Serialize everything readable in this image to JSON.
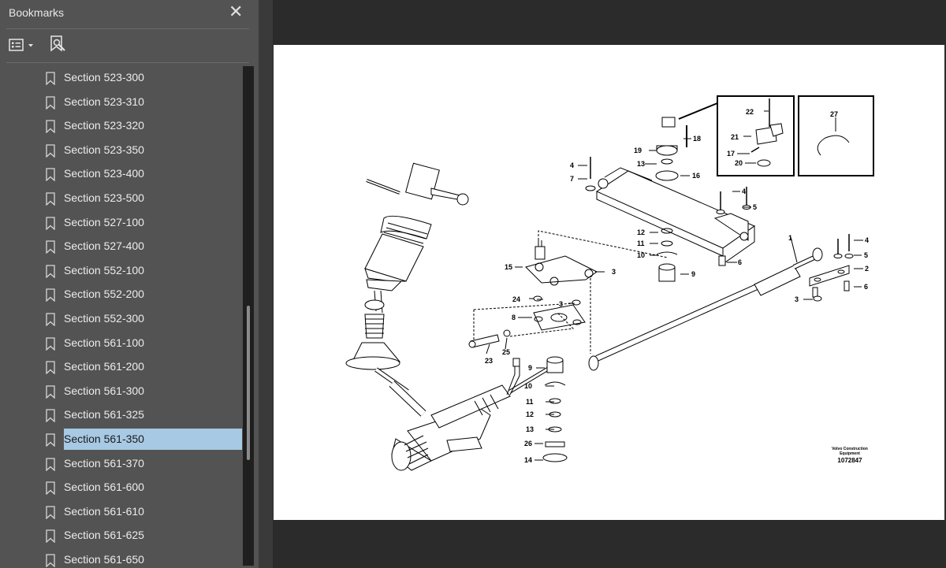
{
  "sidebar": {
    "title": "Bookmarks",
    "close_glyph": "✕",
    "bookmarks": [
      {
        "label": "Section 523-300",
        "selected": false
      },
      {
        "label": "Section 523-310",
        "selected": false
      },
      {
        "label": "Section 523-320",
        "selected": false
      },
      {
        "label": "Section 523-350",
        "selected": false
      },
      {
        "label": "Section 523-400",
        "selected": false
      },
      {
        "label": "Section 523-500",
        "selected": false
      },
      {
        "label": "Section 527-100",
        "selected": false
      },
      {
        "label": "Section 527-400",
        "selected": false
      },
      {
        "label": "Section 552-100",
        "selected": false
      },
      {
        "label": "Section 552-200",
        "selected": false
      },
      {
        "label": "Section 552-300",
        "selected": false
      },
      {
        "label": "Section 561-100",
        "selected": false
      },
      {
        "label": "Section 561-200",
        "selected": false
      },
      {
        "label": "Section 561-300",
        "selected": false
      },
      {
        "label": "Section 561-325",
        "selected": false
      },
      {
        "label": "Section 561-350",
        "selected": true
      },
      {
        "label": "Section 561-370",
        "selected": false
      },
      {
        "label": "Section 561-600",
        "selected": false
      },
      {
        "label": "Section 561-610",
        "selected": false
      },
      {
        "label": "Section 561-625",
        "selected": false
      },
      {
        "label": "Section 561-650",
        "selected": false
      }
    ]
  },
  "colors": {
    "sidebar_bg": "#535353",
    "viewer_bg": "#2b2b2b",
    "selection": "#a7c9e3",
    "page": "#ffffff"
  },
  "drawing": {
    "credit_line1": "Volvo Construction",
    "credit_line2": "Equipment",
    "figure_number": "1072847",
    "callouts": {
      "c1": "1",
      "c2": "2",
      "c3a": "3",
      "c3b": "3",
      "c3c": "3",
      "c4a": "4",
      "c4b": "4",
      "c4c": "4",
      "c5a": "5",
      "c5b": "5",
      "c6a": "6",
      "c6b": "6",
      "c7": "7",
      "c8": "8",
      "c9a": "9",
      "c9b": "9",
      "c10a": "10",
      "c10b": "10",
      "c11a": "11",
      "c11b": "11",
      "c12a": "12",
      "c12b": "12",
      "c13a": "13",
      "c13b": "13",
      "c14": "14",
      "c15": "15",
      "c16": "16",
      "c17": "17",
      "c18": "18",
      "c19": "19",
      "c20": "20",
      "c21": "21",
      "c22": "22",
      "c23": "23",
      "c24": "24",
      "c25": "25",
      "c26": "26",
      "c27": "27"
    }
  }
}
